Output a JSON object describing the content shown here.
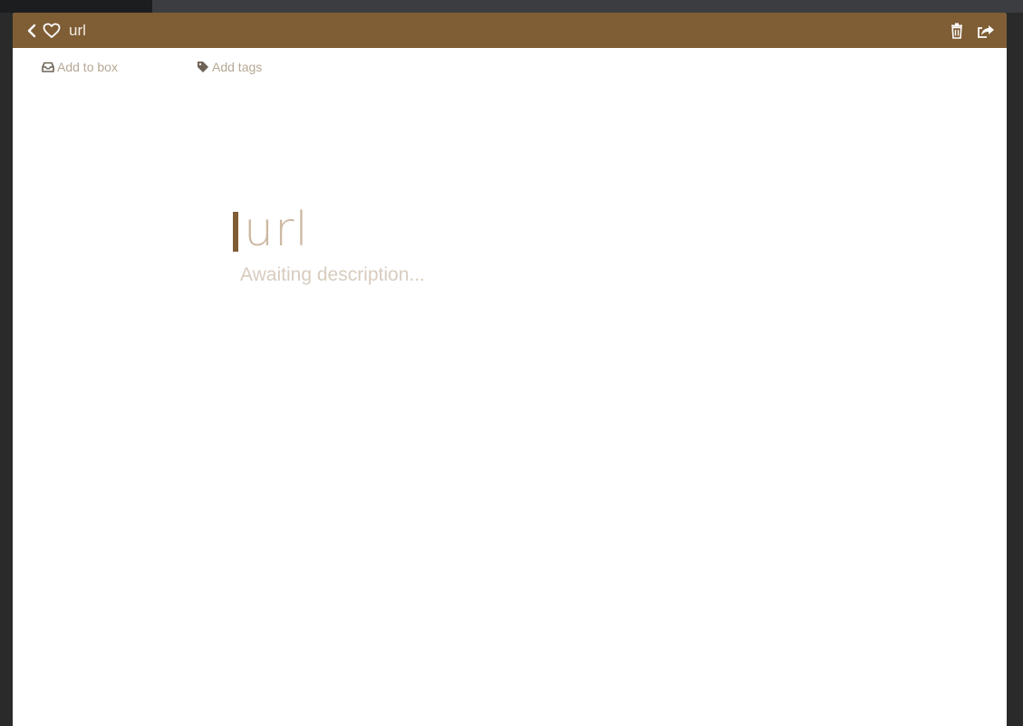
{
  "header": {
    "title": "url",
    "back_icon": "chevron-left-icon",
    "favorite_icon": "heart-outline-icon",
    "delete_icon": "trash-icon",
    "share_icon": "share-icon"
  },
  "actions": {
    "add_to_box": "Add to box",
    "add_tags": "Add tags"
  },
  "item": {
    "title": "url",
    "description": "Awaiting description..."
  },
  "colors": {
    "header_bg": "#7f5d35",
    "accent": "#7f5d35",
    "muted_text": "#b6a794"
  }
}
